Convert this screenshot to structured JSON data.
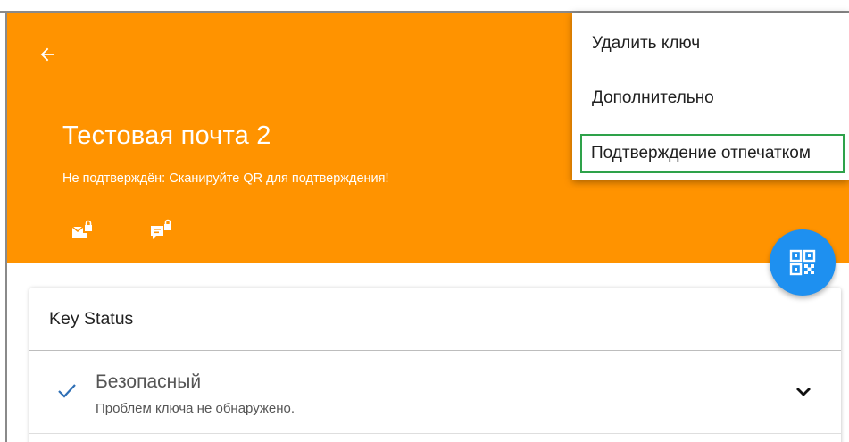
{
  "header": {
    "back_icon": "arrow-left-icon",
    "title": "Тестовая почта 2",
    "subtitle": "Не подтверждён: Сканируйте QR для подтверждения!",
    "icons": [
      "lock-mail-icon",
      "lock-message-icon"
    ],
    "background_color": "#ff9300"
  },
  "menu": {
    "items": [
      {
        "label": "Удалить ключ"
      },
      {
        "label": "Дополнительно"
      },
      {
        "label": "Подтверждение отпечатком",
        "highlighted": true
      }
    ],
    "highlight_color": "#2ea24a"
  },
  "fab": {
    "icon": "qr-code-icon",
    "color": "#1e90f0"
  },
  "key_status": {
    "title": "Key Status",
    "status_icon": "check-icon",
    "status_label": "Безопасный",
    "status_description": "Проблем ключа не обнаружено.",
    "expand_icon": "chevron-down-icon"
  }
}
